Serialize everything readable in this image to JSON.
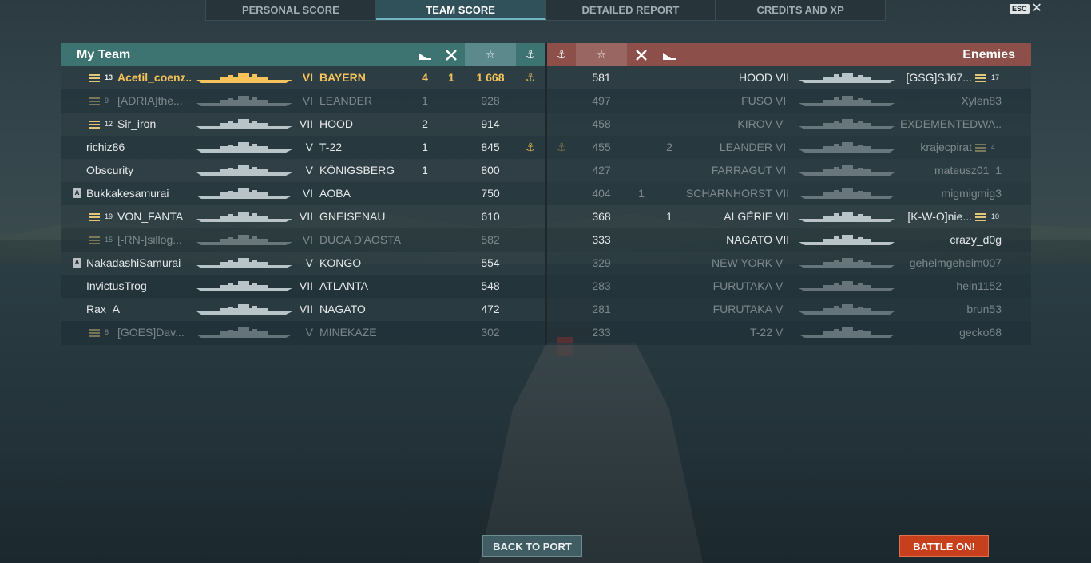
{
  "tabs": [
    "PERSONAL SCORE",
    "TEAM SCORE",
    "DETAILED REPORT",
    "CREDITS AND XP"
  ],
  "active_tab": 1,
  "esc_label": "ESC",
  "close_glyph": "✕",
  "my_team": {
    "title": "My Team",
    "rows": [
      {
        "rank": "13",
        "player": "Acetil_coenz...",
        "tier": "VI",
        "ship": "BAYERN",
        "kills": "4",
        "caps": "1",
        "score": "1 668",
        "medal": "⚓",
        "me": true
      },
      {
        "rank": "9",
        "player": "[ADRIA]the...",
        "tier": "VI",
        "ship": "LEANDER",
        "kills": "1",
        "caps": "",
        "score": "928",
        "medal": "",
        "dim": true
      },
      {
        "rank": "12",
        "player": "Sir_iron",
        "tier": "VII",
        "ship": "HOOD",
        "kills": "2",
        "caps": "",
        "score": "914",
        "medal": ""
      },
      {
        "rank": "",
        "player": "richiz86",
        "tier": "V",
        "ship": "T-22",
        "kills": "1",
        "caps": "",
        "score": "845",
        "medal": "⚓"
      },
      {
        "rank": "",
        "player": "Obscurity",
        "tier": "V",
        "ship": "KÖNIGSBERG",
        "kills": "1",
        "caps": "",
        "score": "800",
        "medal": ""
      },
      {
        "rank": "",
        "player": "Bukkakesamurai",
        "tier": "VI",
        "ship": "AOBA",
        "kills": "",
        "caps": "",
        "score": "750",
        "medal": "",
        "div": "A"
      },
      {
        "rank": "19",
        "player": "VON_FANTA",
        "tier": "VII",
        "ship": "GNEISENAU",
        "kills": "",
        "caps": "",
        "score": "610",
        "medal": ""
      },
      {
        "rank": "15",
        "player": "[-RN-]sillog...",
        "tier": "VI",
        "ship": "DUCA D'AOSTA",
        "kills": "",
        "caps": "",
        "score": "582",
        "medal": "",
        "dim": true
      },
      {
        "rank": "",
        "player": "NakadashiSamurai",
        "tier": "V",
        "ship": "KONGO",
        "kills": "",
        "caps": "",
        "score": "554",
        "medal": "",
        "div": "A"
      },
      {
        "rank": "",
        "player": "InvictusTrog",
        "tier": "VII",
        "ship": "ATLANTA",
        "kills": "",
        "caps": "",
        "score": "548",
        "medal": ""
      },
      {
        "rank": "",
        "player": "Rax_A",
        "tier": "VII",
        "ship": "NAGATO",
        "kills": "",
        "caps": "",
        "score": "472",
        "medal": ""
      },
      {
        "rank": "8",
        "player": "[GOES]Dav...",
        "tier": "V",
        "ship": "MINEKAZE",
        "kills": "",
        "caps": "",
        "score": "302",
        "medal": "",
        "dim": true
      }
    ]
  },
  "enemies": {
    "title": "Enemies",
    "rows": [
      {
        "medal": "",
        "score": "581",
        "caps": "",
        "kills": "",
        "ship": "HOOD",
        "tier": "VII",
        "player": "[GSG]SJ67...",
        "rank": "17"
      },
      {
        "medal": "",
        "score": "497",
        "caps": "",
        "kills": "",
        "ship": "FUSO",
        "tier": "VI",
        "player": "Xylen83",
        "rank": "",
        "dim": true
      },
      {
        "medal": "",
        "score": "458",
        "caps": "",
        "kills": "",
        "ship": "KIROV",
        "tier": "V",
        "player": "EXDEMENTEDWA...",
        "rank": "",
        "dim": true
      },
      {
        "medal": "⚓",
        "score": "455",
        "caps": "",
        "kills": "2",
        "ship": "LEANDER",
        "tier": "VI",
        "player": "krajecpirat",
        "rank": "4",
        "dim": true
      },
      {
        "medal": "",
        "score": "427",
        "caps": "",
        "kills": "",
        "ship": "FARRAGUT",
        "tier": "VI",
        "player": "mateusz01_1",
        "rank": "",
        "dim": true
      },
      {
        "medal": "",
        "score": "404",
        "caps": "1",
        "kills": "",
        "ship": "SCHARNHORST",
        "tier": "VII",
        "player": "migmigmig3",
        "rank": "",
        "dim": true
      },
      {
        "medal": "",
        "score": "368",
        "caps": "",
        "kills": "1",
        "ship": "ALGÉRIE",
        "tier": "VII",
        "player": "[K-W-O]nie...",
        "rank": "10"
      },
      {
        "medal": "",
        "score": "333",
        "caps": "",
        "kills": "",
        "ship": "NAGATO",
        "tier": "VII",
        "player": "crazy_d0g",
        "rank": ""
      },
      {
        "medal": "",
        "score": "329",
        "caps": "",
        "kills": "",
        "ship": "NEW YORK",
        "tier": "V",
        "player": "geheimgeheim007",
        "rank": "",
        "dim": true
      },
      {
        "medal": "",
        "score": "283",
        "caps": "",
        "kills": "",
        "ship": "FURUTAKA",
        "tier": "V",
        "player": "hein1152",
        "rank": "",
        "dim": true
      },
      {
        "medal": "",
        "score": "281",
        "caps": "",
        "kills": "",
        "ship": "FURUTAKA",
        "tier": "V",
        "player": "brun53",
        "rank": "",
        "dim": true
      },
      {
        "medal": "",
        "score": "233",
        "caps": "",
        "kills": "",
        "ship": "T-22",
        "tier": "V",
        "player": "gecko68",
        "rank": "",
        "dim": true
      }
    ]
  },
  "header_icons": {
    "kills": "torpedo-kill-icon",
    "caps": "capture-icon",
    "score": "☆",
    "medal": "⚓"
  },
  "buttons": {
    "back": "BACK TO PORT",
    "battle": "BATTLE ON!"
  },
  "colors": {
    "my_team": "#3d7370",
    "enemies": "#8c4f49",
    "me": "#f5c35a",
    "battle": "#c83f1b"
  }
}
